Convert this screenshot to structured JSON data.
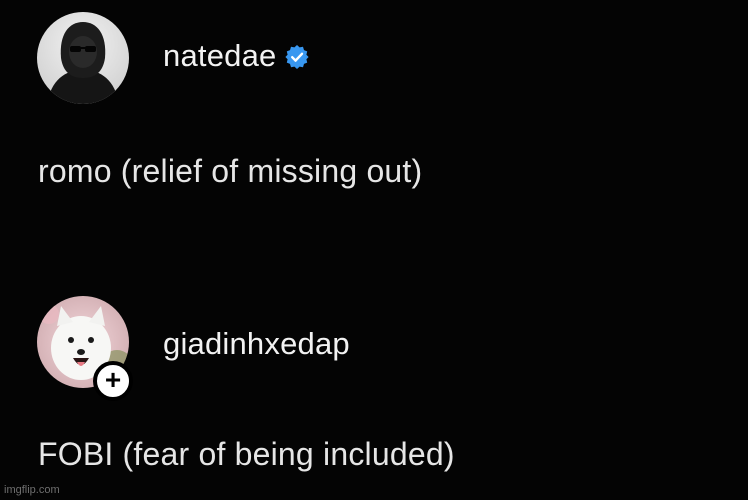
{
  "posts": [
    {
      "username": "natedae",
      "verified": true,
      "caption": "romo (relief of missing out)",
      "avatar": "hooded-person-sunglasses-avatar"
    },
    {
      "username": "giadinhxedap",
      "verified": false,
      "caption": "FOBI (fear of being included)",
      "avatar": "white-dog-avatar",
      "follow_symbol": "+"
    }
  ],
  "watermark": "imgflip.com",
  "colors": {
    "background": "#040404",
    "text": "#e6e6e6",
    "verified_badge": "#3897f0",
    "follow_button": "#ffffff"
  }
}
